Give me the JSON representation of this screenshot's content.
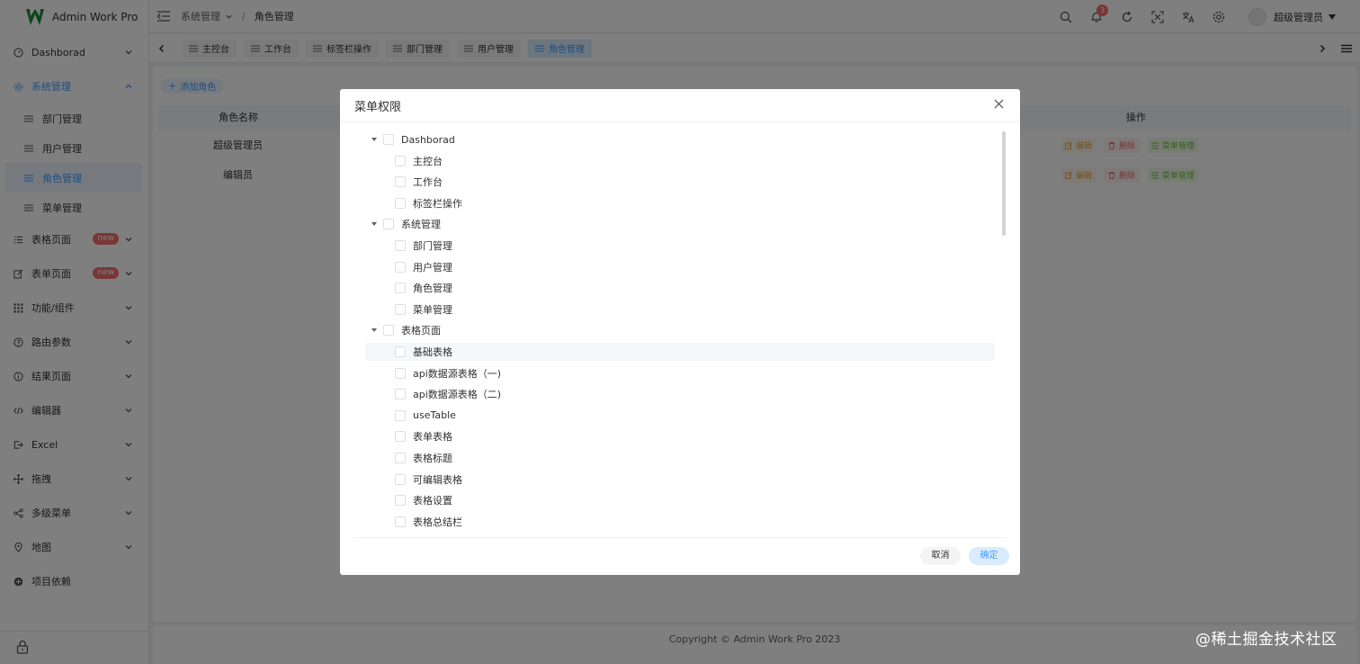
{
  "app": {
    "title": "Admin Work Pro"
  },
  "sidebar": {
    "items": [
      {
        "label": "Dashborad",
        "icon": "dashboard-icon"
      },
      {
        "label": "系统管理",
        "icon": "gear-icon",
        "children": [
          "部门管理",
          "用户管理",
          "角色管理",
          "菜单管理"
        ]
      },
      {
        "label": "表格页面",
        "icon": "list-icon",
        "badge": "new"
      },
      {
        "label": "表单页面",
        "icon": "form-icon",
        "badge": "new"
      },
      {
        "label": "功能/组件",
        "icon": "grid-icon"
      },
      {
        "label": "路由参数",
        "icon": "route-icon"
      },
      {
        "label": "结果页面",
        "icon": "info-icon"
      },
      {
        "label": "编辑器",
        "icon": "code-icon"
      },
      {
        "label": "Excel",
        "icon": "export-icon"
      },
      {
        "label": "拖拽",
        "icon": "move-icon"
      },
      {
        "label": "多级菜单",
        "icon": "share-icon"
      },
      {
        "label": "地图",
        "icon": "location-icon"
      },
      {
        "label": "项目依赖",
        "icon": "package-icon"
      }
    ]
  },
  "header": {
    "breadcrumb": [
      "系统管理",
      "角色管理"
    ],
    "bell_count": "3",
    "username": "超级管理员"
  },
  "tabs": [
    "主控台",
    "工作台",
    "标签栏操作",
    "部门管理",
    "用户管理",
    "角色管理"
  ],
  "main": {
    "add_button": "添加角色",
    "columns": {
      "name": "角色名称",
      "actions": "操作"
    },
    "rows": [
      {
        "name": "超级管理员"
      },
      {
        "name": "编辑员"
      }
    ],
    "actions": {
      "edit": "编辑",
      "delete": "删除",
      "menu": "菜单管理"
    }
  },
  "footer": {
    "copyright": "Copyright © Admin Work Pro 2023"
  },
  "dialog": {
    "title": "菜单权限",
    "tree": [
      {
        "label": "Dashborad",
        "level": 0
      },
      {
        "label": "主控台",
        "level": 1
      },
      {
        "label": "工作台",
        "level": 1
      },
      {
        "label": "标签栏操作",
        "level": 1
      },
      {
        "label": "系统管理",
        "level": 0
      },
      {
        "label": "部门管理",
        "level": 1
      },
      {
        "label": "用户管理",
        "level": 1
      },
      {
        "label": "角色管理",
        "level": 1
      },
      {
        "label": "菜单管理",
        "level": 1
      },
      {
        "label": "表格页面",
        "level": 0
      },
      {
        "label": "基础表格",
        "level": 1
      },
      {
        "label": "api数据源表格（一)",
        "level": 1
      },
      {
        "label": "api数据源表格（二)",
        "level": 1
      },
      {
        "label": "useTable",
        "level": 1
      },
      {
        "label": "表单表格",
        "level": 1
      },
      {
        "label": "表格标题",
        "level": 1
      },
      {
        "label": "可编辑表格",
        "level": 1
      },
      {
        "label": "表格设置",
        "level": 1
      },
      {
        "label": "表格总结栏",
        "level": 1
      }
    ],
    "cancel": "取消",
    "confirm": "确定"
  },
  "watermark": "@稀土掘金技术社区",
  "colors": {
    "primary": "#409eff",
    "danger": "#f56c6c",
    "warning": "#e6a23c",
    "success": "#67c23a"
  }
}
